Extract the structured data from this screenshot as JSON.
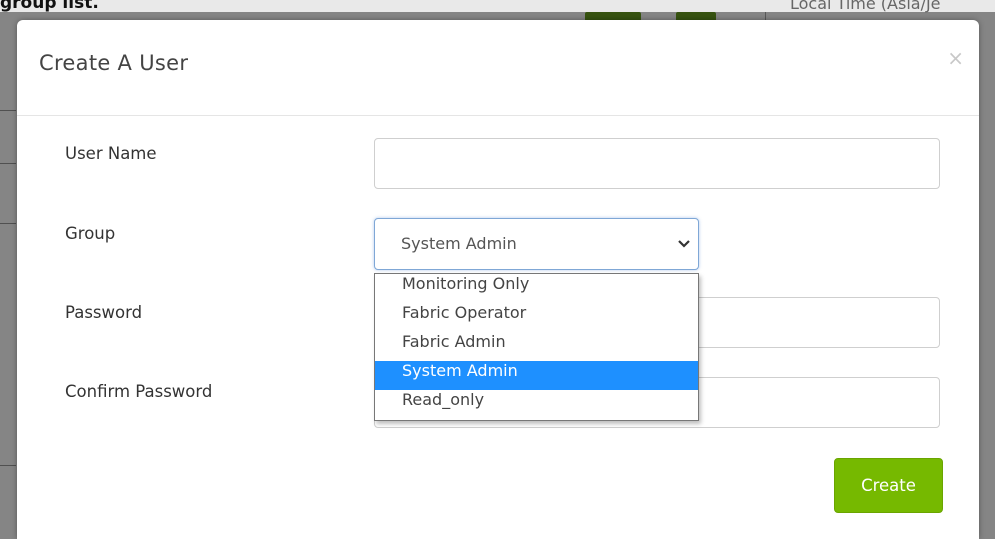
{
  "background": {
    "caption": "group list.",
    "header_text": "Local Time (Asia/Je"
  },
  "modal": {
    "title": "Create A User",
    "close_icon": "close-icon",
    "fields": {
      "username": {
        "label": "User Name",
        "value": "",
        "placeholder": ""
      },
      "group": {
        "label": "Group",
        "selected": "System Admin",
        "options": [
          "Monitoring Only",
          "Fabric Operator",
          "Fabric Admin",
          "System Admin",
          "Read_only"
        ],
        "highlighted_index": 3
      },
      "password": {
        "label": "Password",
        "value": ""
      },
      "confirm_password": {
        "label": "Confirm Password",
        "value": ""
      }
    },
    "create_label": "Create"
  },
  "colors": {
    "accent": "#76b900",
    "selection": "#1e90ff",
    "focus_border": "#7fa7d6"
  }
}
